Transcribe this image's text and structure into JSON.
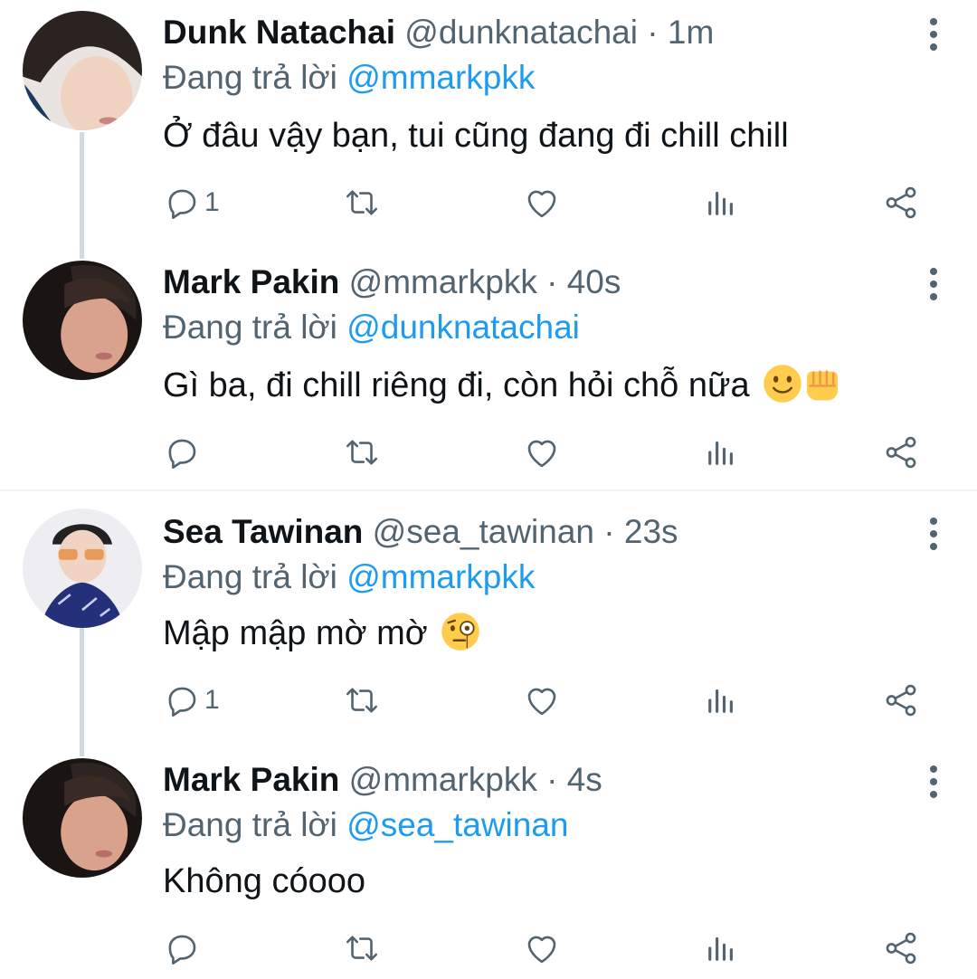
{
  "reply_prefix": "Đang trả lời",
  "colors": {
    "name": "#0f1419",
    "meta": "#536471",
    "mention": "#1d9bf0",
    "thread_line": "#cfd9de"
  },
  "tweets": [
    {
      "name": "Dunk Natachai",
      "handle": "@dunknatachai",
      "separator": "·",
      "time": "1m",
      "replying_to": "@mmarkpkk",
      "text": "Ở đâu vậy bạn, tui cũng đang đi chill chill",
      "reply_count": "1",
      "icons": [
        "reply-icon",
        "retweet-icon",
        "like-icon",
        "analytics-icon",
        "share-icon",
        "more-icon"
      ]
    },
    {
      "name": "Mark Pakin",
      "handle": "@mmarkpkk",
      "separator": "·",
      "time": "40s",
      "replying_to": "@dunknatachai",
      "text": "Gì ba, đi chill riêng đi, còn hỏi chỗ nữa",
      "emojis": [
        "slightly-smiling-face-emoji",
        "fist-bump-emoji"
      ],
      "reply_count": "",
      "icons": [
        "reply-icon",
        "retweet-icon",
        "like-icon",
        "analytics-icon",
        "share-icon",
        "more-icon"
      ]
    },
    {
      "name": "Sea Tawinan",
      "handle": "@sea_tawinan",
      "separator": "·",
      "time": "23s",
      "replying_to": "@mmarkpkk",
      "text": "Mập mập mờ mờ",
      "emojis": [
        "face-with-monocle-emoji"
      ],
      "reply_count": "1",
      "icons": [
        "reply-icon",
        "retweet-icon",
        "like-icon",
        "analytics-icon",
        "share-icon",
        "more-icon"
      ]
    },
    {
      "name": "Mark Pakin",
      "handle": "@mmarkpkk",
      "separator": "·",
      "time": "4s",
      "replying_to": "@sea_tawinan",
      "text": "Không cóooo",
      "reply_count": "",
      "icons": [
        "reply-icon",
        "retweet-icon",
        "like-icon",
        "analytics-icon",
        "share-icon",
        "more-icon"
      ]
    }
  ]
}
